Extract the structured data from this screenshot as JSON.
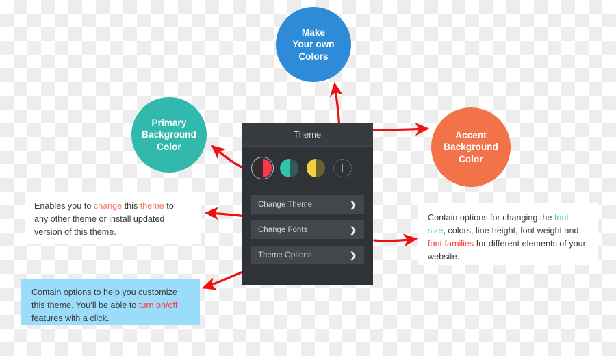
{
  "bubbles": [
    {
      "id": "make-colors",
      "lines": [
        "Make",
        "Your own",
        "Colors"
      ],
      "color": "#2e8bd8"
    },
    {
      "id": "primary",
      "lines": [
        "Primary",
        "Background",
        "Color"
      ],
      "color": "#32b9ad"
    },
    {
      "id": "accent",
      "lines": [
        "Accent",
        "Background",
        "Color"
      ],
      "color": "#f2734a"
    }
  ],
  "panel": {
    "title": "Theme",
    "background": "#2f3337",
    "header_background": "#383c41",
    "swatches": [
      {
        "name": "red-swatch",
        "left_color": "#3a2a2c",
        "right_color": "#f8384c",
        "selected": true
      },
      {
        "name": "teal-swatch",
        "left_color": "#2fc4ab",
        "right_color": "#2f5d56",
        "selected": false
      },
      {
        "name": "yellow-swatch",
        "left_color": "#f2d13f",
        "right_color": "#6b6130",
        "selected": false
      }
    ],
    "add_swatch_label": "+",
    "buttons": [
      {
        "name": "change-theme",
        "label": "Change Theme",
        "chevron": "❯"
      },
      {
        "name": "change-fonts",
        "label": "Change Fonts",
        "chevron": "❯"
      },
      {
        "name": "theme-options",
        "label": "Theme Options",
        "chevron": "❯"
      }
    ]
  },
  "callouts": {
    "left_top": {
      "background": "#ffffff",
      "segments": [
        {
          "text": "Enables you to ",
          "style": "plain"
        },
        {
          "text": "change",
          "style": "orange"
        },
        {
          "text": " this ",
          "style": "plain"
        },
        {
          "text": "theme",
          "style": "orange"
        },
        {
          "text": " to any other theme or install updated version of this theme.",
          "style": "plain"
        }
      ]
    },
    "right": {
      "background": "#ffffff",
      "segments": [
        {
          "text": "Contain options for changing the ",
          "style": "plain"
        },
        {
          "text": "font size",
          "style": "teal"
        },
        {
          "text": ", colors, line-height, font weight and ",
          "style": "plain"
        },
        {
          "text": "font families",
          "style": "red"
        },
        {
          "text": " for different elements of your website.",
          "style": "plain"
        }
      ]
    },
    "left_bottom": {
      "background": "#9bdcfb",
      "segments": [
        {
          "text": "Contain options to help you customize this theme. You’ll be able to ",
          "style": "plain"
        },
        {
          "text": "turn on/off",
          "style": "red"
        },
        {
          "text": " features with a click.",
          "style": "plain"
        }
      ]
    }
  },
  "arrows": {
    "color": "#ee1111",
    "items": [
      {
        "name": "arrow-swatch-to-primary",
        "from": "red-swatch",
        "to": "primary-bubble"
      },
      {
        "name": "arrow-add-to-make-colors",
        "from": "add-swatch",
        "to": "make-colors-bubble"
      },
      {
        "name": "arrow-panel-to-accent",
        "from": "theme-panel",
        "to": "accent-bubble"
      },
      {
        "name": "arrow-change-theme-callout",
        "from": "change-theme",
        "to": "left-top-callout"
      },
      {
        "name": "arrow-change-fonts-callout",
        "from": "change-fonts",
        "to": "right-callout"
      },
      {
        "name": "arrow-theme-options-callout",
        "from": "theme-options",
        "to": "left-bottom-callout"
      }
    ]
  }
}
